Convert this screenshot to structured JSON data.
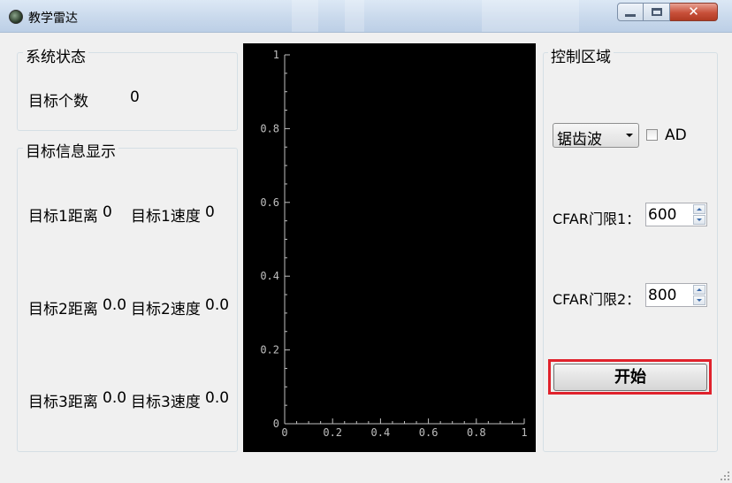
{
  "window": {
    "title": "教学雷达"
  },
  "status_group": {
    "title": "系统状态",
    "target_count_label": "目标个数",
    "target_count_value": "0"
  },
  "target_info_group": {
    "title": "目标信息显示",
    "targets": [
      {
        "distance_label": "目标1距离",
        "distance_value": "0",
        "speed_label": "目标1速度",
        "speed_value": "0"
      },
      {
        "distance_label": "目标2距离",
        "distance_value": "0.0",
        "speed_label": "目标2速度",
        "speed_value": "0.0"
      },
      {
        "distance_label": "目标3距离",
        "distance_value": "0.0",
        "speed_label": "目标3速度",
        "speed_value": "0.0"
      }
    ]
  },
  "plot": {
    "y_ticks": [
      "0",
      "0.2",
      "0.4",
      "0.6",
      "0.8",
      "1"
    ],
    "x_ticks": [
      "0",
      "0.2",
      "0.4",
      "0.6",
      "0.8",
      "1"
    ]
  },
  "chart_data": {
    "type": "line",
    "series": [],
    "xlim": [
      0,
      1
    ],
    "ylim": [
      0,
      1
    ],
    "x_ticks": [
      0,
      0.2,
      0.4,
      0.6,
      0.8,
      1
    ],
    "y_ticks": [
      0,
      0.2,
      0.4,
      0.6,
      0.8,
      1
    ],
    "background": "#000000",
    "axis_color": "#bfbfbf",
    "grid": false
  },
  "control_group": {
    "title": "控制区域",
    "waveform_selected": "锯齿波",
    "ad_label": "AD",
    "ad_checked": false,
    "cfar1_label": "CFAR门限1：",
    "cfar1_value": "600",
    "cfar2_label": "CFAR门限2：",
    "cfar2_value": "800",
    "start_label": "开始"
  },
  "colors": {
    "highlight": "#e0222c",
    "plot_bg": "#000000",
    "window_bg": "#f0f0f0"
  }
}
